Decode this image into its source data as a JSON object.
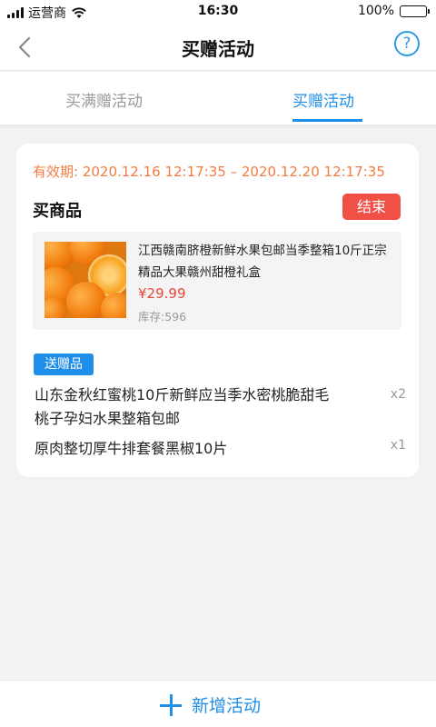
{
  "status_bar": {
    "carrier": "运营商",
    "time": "16:30",
    "battery": "100%"
  },
  "nav": {
    "title": "买赠活动",
    "help_icon": "?"
  },
  "tabs": [
    {
      "label": "买满赠活动",
      "active": false
    },
    {
      "label": "买赠活动",
      "active": true
    }
  ],
  "activity": {
    "validity": "有效期: 2020.12.16 12:17:35 – 2020.12.20 12:17:35",
    "buy_title": "买商品",
    "end_label": "结束",
    "product": {
      "name": "江西赣南脐橙新鲜水果包邮当季整箱10斤正宗精品大果赣州甜橙礼盒",
      "price": "¥29.99",
      "stock": "库存:596"
    },
    "gift_badge": "送赠品",
    "gifts": [
      {
        "name": "山东金秋红蜜桃10斤新鲜应当季水密桃脆甜毛桃子孕妇水果整箱包邮",
        "qty": "x2"
      },
      {
        "name": "原肉整切厚牛排套餐黑椒10片",
        "qty": "x1"
      }
    ]
  },
  "bottom": {
    "add_label": "新增活动"
  },
  "colors": {
    "accent": "#1f8ee8",
    "warning": "#f27c42",
    "danger": "#f05046",
    "price": "#e8453c"
  }
}
